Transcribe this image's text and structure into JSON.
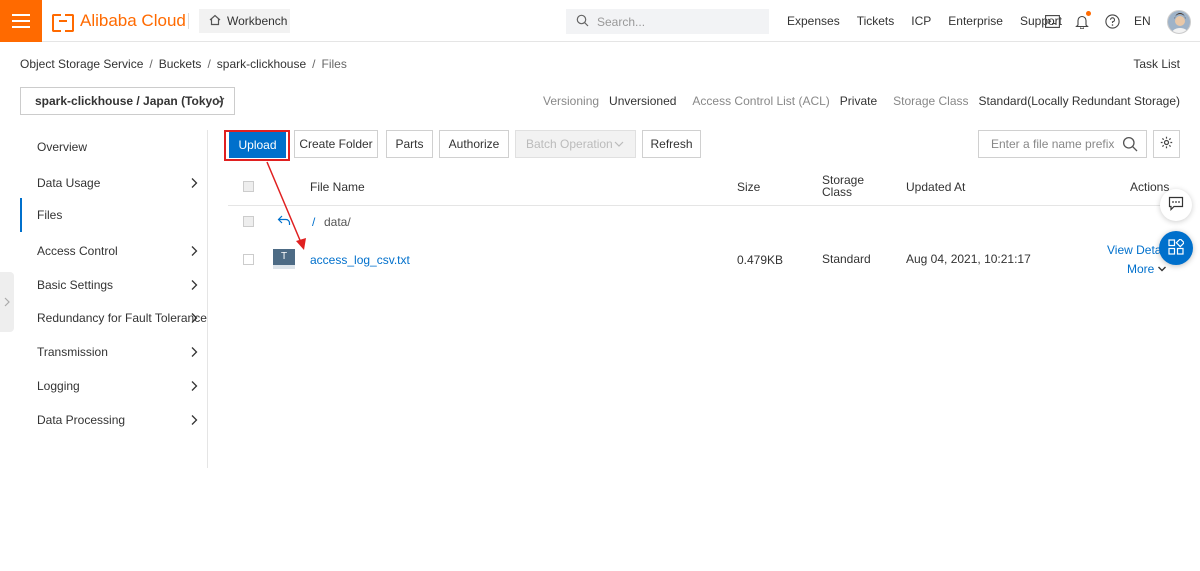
{
  "brand": {
    "name": "Alibaba Cloud",
    "accent": "#ff6a00",
    "link_color": "#0070cc"
  },
  "topbar": {
    "workbench_label": "Workbench",
    "search_placeholder": "Search...",
    "links": [
      "Expenses",
      "Tickets",
      "ICP",
      "Enterprise",
      "Support"
    ],
    "language": "EN"
  },
  "breadcrumb": [
    "Object Storage Service",
    "Buckets",
    "spark-clickhouse",
    "Files"
  ],
  "task_list_label": "Task List",
  "bucket": {
    "selector": "spark-clickhouse / Japan (Tokyo)",
    "versioning_label": "Versioning",
    "versioning_value": "Unversioned",
    "acl_label": "Access Control List (ACL)",
    "acl_value": "Private",
    "storage_class_label": "Storage Class",
    "storage_class_value": "Standard(Locally Redundant Storage)"
  },
  "sidebar": {
    "items": [
      {
        "label": "Overview",
        "has_arrow": false
      },
      {
        "label": "Data Usage",
        "has_arrow": true
      },
      {
        "label": "Files",
        "has_arrow": false,
        "active": true
      },
      {
        "label": "Access Control",
        "has_arrow": true
      },
      {
        "label": "Basic Settings",
        "has_arrow": true
      },
      {
        "label": "Redundancy for Fault Tolerance",
        "has_arrow": true
      },
      {
        "label": "Transmission",
        "has_arrow": true
      },
      {
        "label": "Logging",
        "has_arrow": true
      },
      {
        "label": "Data Processing",
        "has_arrow": true
      }
    ]
  },
  "toolbar": {
    "upload": "Upload",
    "create_folder": "Create Folder",
    "parts": "Parts",
    "authorize": "Authorize",
    "batch_operation": "Batch Operation",
    "refresh": "Refresh",
    "prefix_placeholder": "Enter a file name prefix"
  },
  "table": {
    "headers": {
      "file_name": "File Name",
      "size": "Size",
      "storage_class_line1": "Storage",
      "storage_class_line2": "Class",
      "updated_at": "Updated At",
      "actions": "Actions"
    },
    "parent_row": {
      "path_link": "/",
      "path_text": "data/"
    },
    "rows": [
      {
        "icon_letter": "T",
        "name": "access_log_csv.txt",
        "size": "0.479KB",
        "storage_class": "Standard",
        "updated_at": "Aug 04, 2021, 10:21:17",
        "action_view": "View Details",
        "action_more": "More"
      }
    ]
  }
}
